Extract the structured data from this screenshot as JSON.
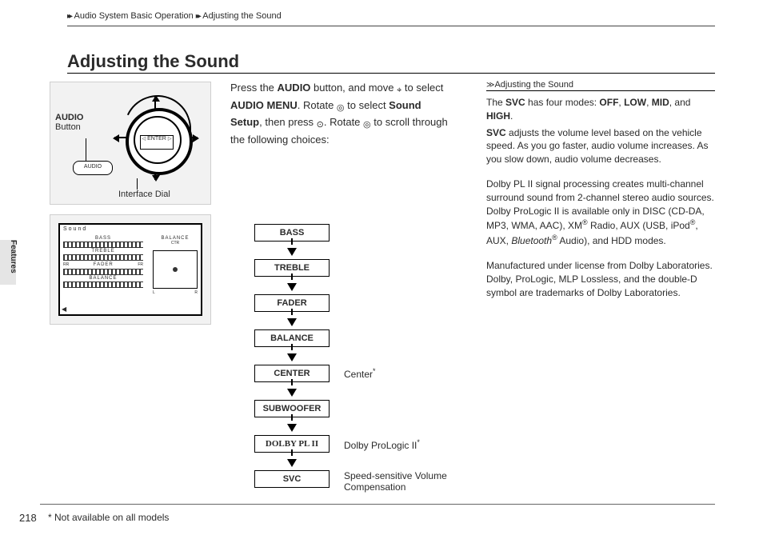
{
  "breadcrumb": {
    "a": "Audio System Basic Operation",
    "b": "Adjusting the Sound"
  },
  "title": "Adjusting the Sound",
  "sidetab": "Features",
  "fig1": {
    "audio_label_1": "AUDIO",
    "audio_label_2": "Button",
    "dial_label": "Interface Dial",
    "enter": "ENTER",
    "audio_btn": "AUDIO"
  },
  "fig2": {
    "title": "Sound",
    "rows": [
      "BASS",
      "TREBLE",
      "FADER",
      "BALANCE"
    ],
    "rr": "RR",
    "fr": "FR",
    "l": "L",
    "r": "R",
    "balance": "BALANCE",
    "ctr": "CTR"
  },
  "intro": {
    "t1": "Press the ",
    "b1": "AUDIO",
    "t2": " button, and move ",
    "t3": " to select ",
    "b2": "AUDIO MENU",
    "t4": ". Rotate ",
    "t5": " to select ",
    "b3": "Sound Setup",
    "t6": ", then press ",
    "t7": ". Rotate ",
    "t8": " to scroll through the following choices:"
  },
  "flow": {
    "items": [
      "BASS",
      "TREBLE",
      "FADER",
      "BALANCE",
      "CENTER",
      "SUBWOOFER",
      "DOLBY PL II",
      "SVC"
    ]
  },
  "annotations": {
    "center": "Center",
    "dolby": "Dolby ProLogic II",
    "svc1": "Speed-sensitive Volume",
    "svc2": "Compensation",
    "star": "*"
  },
  "info": {
    "header": "Adjusting the Sound",
    "p1a": "The ",
    "p1b": "SVC",
    "p1c": " has four modes: ",
    "p1d": "OFF",
    "p1e": ", ",
    "p1f": "LOW",
    "p1g": ", ",
    "p1h": "MID",
    "p1i": ", and ",
    "p1j": "HIGH",
    "p1k": ".",
    "p2a": "SVC",
    "p2b": " adjusts the volume level based on the vehicle speed. As you go faster, audio volume increases. As you slow down, audio volume decreases.",
    "p3a": "Dolby PL II signal processing creates multi-channel surround sound from 2-channel stereo audio sources. Dolby ProLogic II is available only in DISC (CD-DA, MP3, WMA, AAC), XM",
    "p3reg1": "®",
    "p3b": " Radio, AUX (USB, iPod",
    "p3reg2": "®",
    "p3c": ", AUX, ",
    "p3it": "Bluetooth",
    "p3reg3": "®",
    "p3d": " Audio), and HDD modes.",
    "p4": "Manufactured under license from Dolby Laboratories. Dolby, ProLogic, MLP Lossless, and the double-D symbol are trademarks of Dolby Laboratories."
  },
  "footer": {
    "page": "218",
    "note": "* Not available on all models"
  },
  "glyphs": {
    "joystick": "⌖",
    "dial": "◎",
    "press": "⊙",
    "chev": "▸▸"
  }
}
